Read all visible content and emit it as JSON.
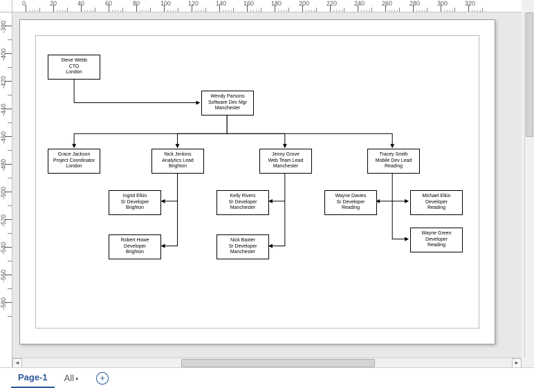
{
  "ruler": {
    "h_labels": [
      "0",
      "20",
      "40",
      "60",
      "80",
      "100",
      "120",
      "140",
      "160",
      "180",
      "200",
      "220",
      "240",
      "260",
      "280",
      "300",
      "320"
    ],
    "v_labels": [
      "-380",
      "-400",
      "-420",
      "-440",
      "-460",
      "-480",
      "-500",
      "-520",
      "-540",
      "-560",
      "-580"
    ]
  },
  "nodes": {
    "cto": {
      "name": "Steve Webb",
      "role": "CTO",
      "loc": "London"
    },
    "mgr": {
      "name": "Wendy Parsons",
      "role": "Software Dev Mgr",
      "loc": "Manchester"
    },
    "pc": {
      "name": "Grace Jackson",
      "role": "Project Coordinator",
      "loc": "London"
    },
    "al": {
      "name": "Nick Jenkins",
      "role": "Analytics Lead",
      "loc": "Brighton"
    },
    "wtl": {
      "name": "Jenny Grove",
      "role": "Web Team Lead",
      "loc": "Manchester"
    },
    "mdl": {
      "name": "Tracey Smith",
      "role": "Mobile Dev Lead",
      "loc": "Reading"
    },
    "al_a": {
      "name": "Ingrid Elkin",
      "role": "Sr Developer",
      "loc": "Brighton"
    },
    "al_b": {
      "name": "Robert Howe",
      "role": "Developer",
      "loc": "Brighton"
    },
    "wtl_a": {
      "name": "Kelly Rivers",
      "role": "Sr Developer",
      "loc": "Manchester"
    },
    "wtl_b": {
      "name": "Nick Baxter",
      "role": "Sr Developer",
      "loc": "Manchester"
    },
    "mdl_a": {
      "name": "Wayne Davies",
      "role": "Sr Developer",
      "loc": "Reading"
    },
    "mdl_b": {
      "name": "Michael Elkin",
      "role": "Developer",
      "loc": "Reading"
    },
    "mdl_c": {
      "name": "Wayne Green",
      "role": "Developer",
      "loc": "Reading"
    }
  },
  "tabs": {
    "page": "Page-1",
    "all": "All"
  },
  "scroll_arrows": {
    "left": "◄",
    "right": "►"
  }
}
